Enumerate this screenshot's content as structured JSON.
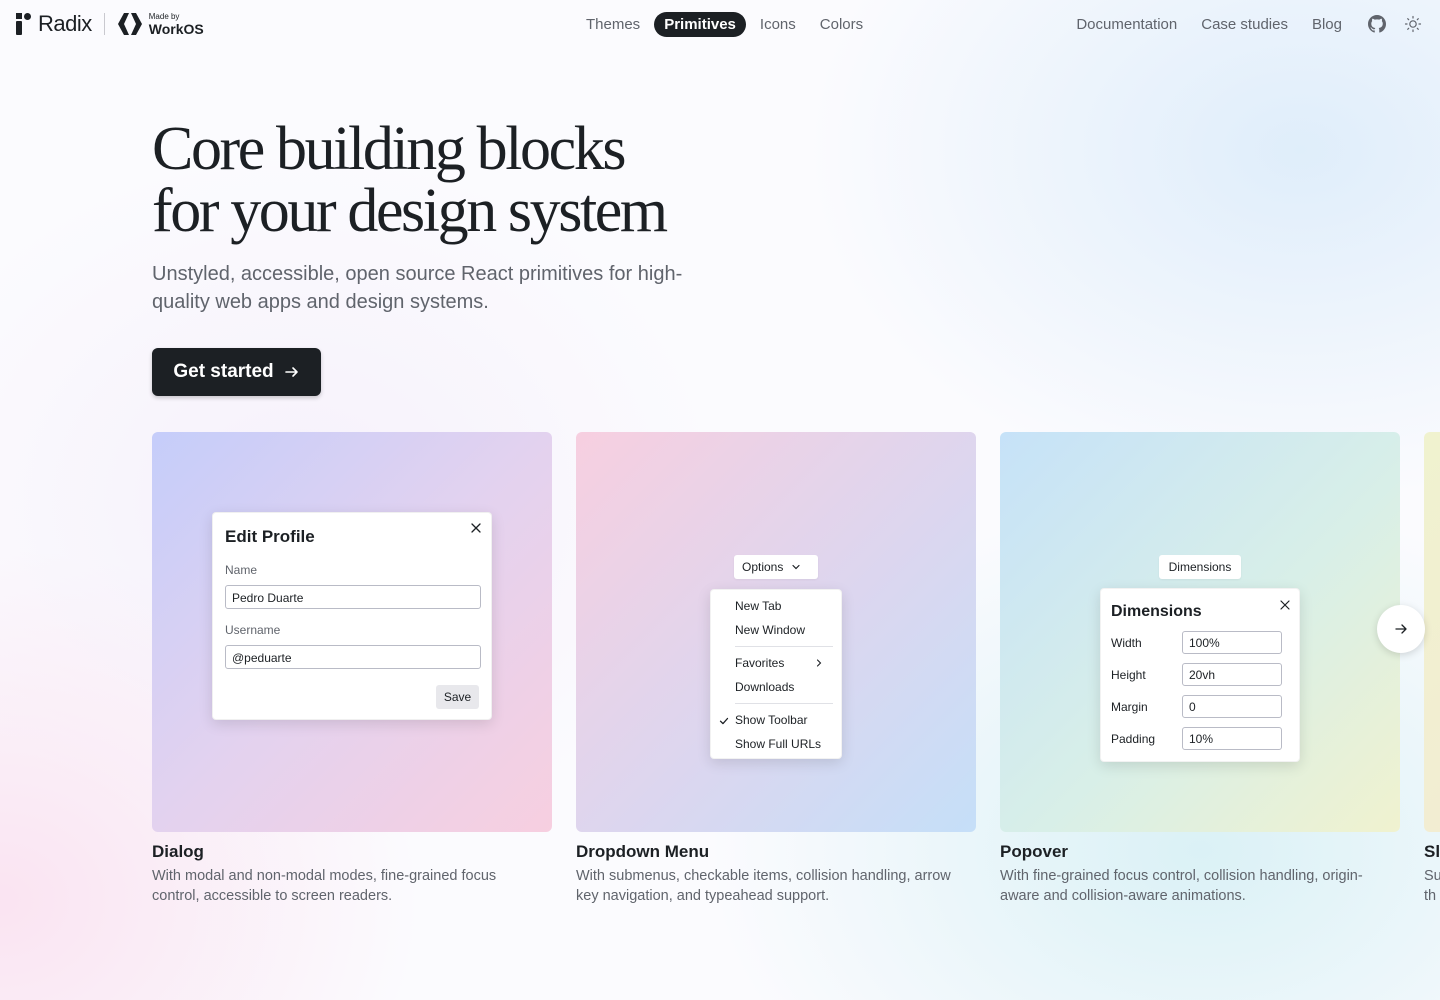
{
  "brand": {
    "name": "Radix",
    "partner_small": "Made by",
    "partner_name": "WorkOS"
  },
  "nav": {
    "center": [
      {
        "label": "Themes",
        "active": false
      },
      {
        "label": "Primitives",
        "active": true
      },
      {
        "label": "Icons",
        "active": false
      },
      {
        "label": "Colors",
        "active": false
      }
    ],
    "right": [
      {
        "label": "Documentation"
      },
      {
        "label": "Case studies"
      },
      {
        "label": "Blog"
      }
    ],
    "icons": [
      "github-icon",
      "sun-icon"
    ]
  },
  "hero": {
    "title_line1": "Core building blocks",
    "title_line2": "for your design system",
    "subtitle": "Unstyled, accessible, open source React primitives for high-quality web apps and design systems.",
    "cta_label": "Get started"
  },
  "cards": [
    {
      "title": "Dialog",
      "description": "With modal and non-modal modes, fine-grained focus control, accessible to screen readers.",
      "demo": {
        "title": "Edit Profile",
        "name_label": "Name",
        "name_value": "Pedro Duarte",
        "username_label": "Username",
        "username_value": "@peduarte",
        "save_label": "Save"
      }
    },
    {
      "title": "Dropdown Menu",
      "description": "With submenus, checkable items, collision handling, arrow key navigation, and typeahead support.",
      "demo": {
        "trigger_label": "Options",
        "items": [
          "New Tab",
          "New Window",
          "Favorites",
          "Downloads",
          "Show Toolbar",
          "Show Full URLs"
        ],
        "checked_item": "Show Toolbar"
      }
    },
    {
      "title": "Popover",
      "description": "With fine-grained focus control, collision handling, origin-aware and collision-aware animations.",
      "demo": {
        "trigger_label": "Dimensions",
        "title": "Dimensions",
        "fields": [
          {
            "label": "Width",
            "value": "100%"
          },
          {
            "label": "Height",
            "value": "20vh"
          },
          {
            "label": "Margin",
            "value": "0"
          },
          {
            "label": "Padding",
            "value": "10%"
          }
        ]
      }
    },
    {
      "title": "Sl",
      "description_lines": [
        "Su",
        "th"
      ]
    }
  ],
  "colors": {
    "text": "#1c2024",
    "muted": "#60646c",
    "accent_dark": "#1c2024"
  }
}
